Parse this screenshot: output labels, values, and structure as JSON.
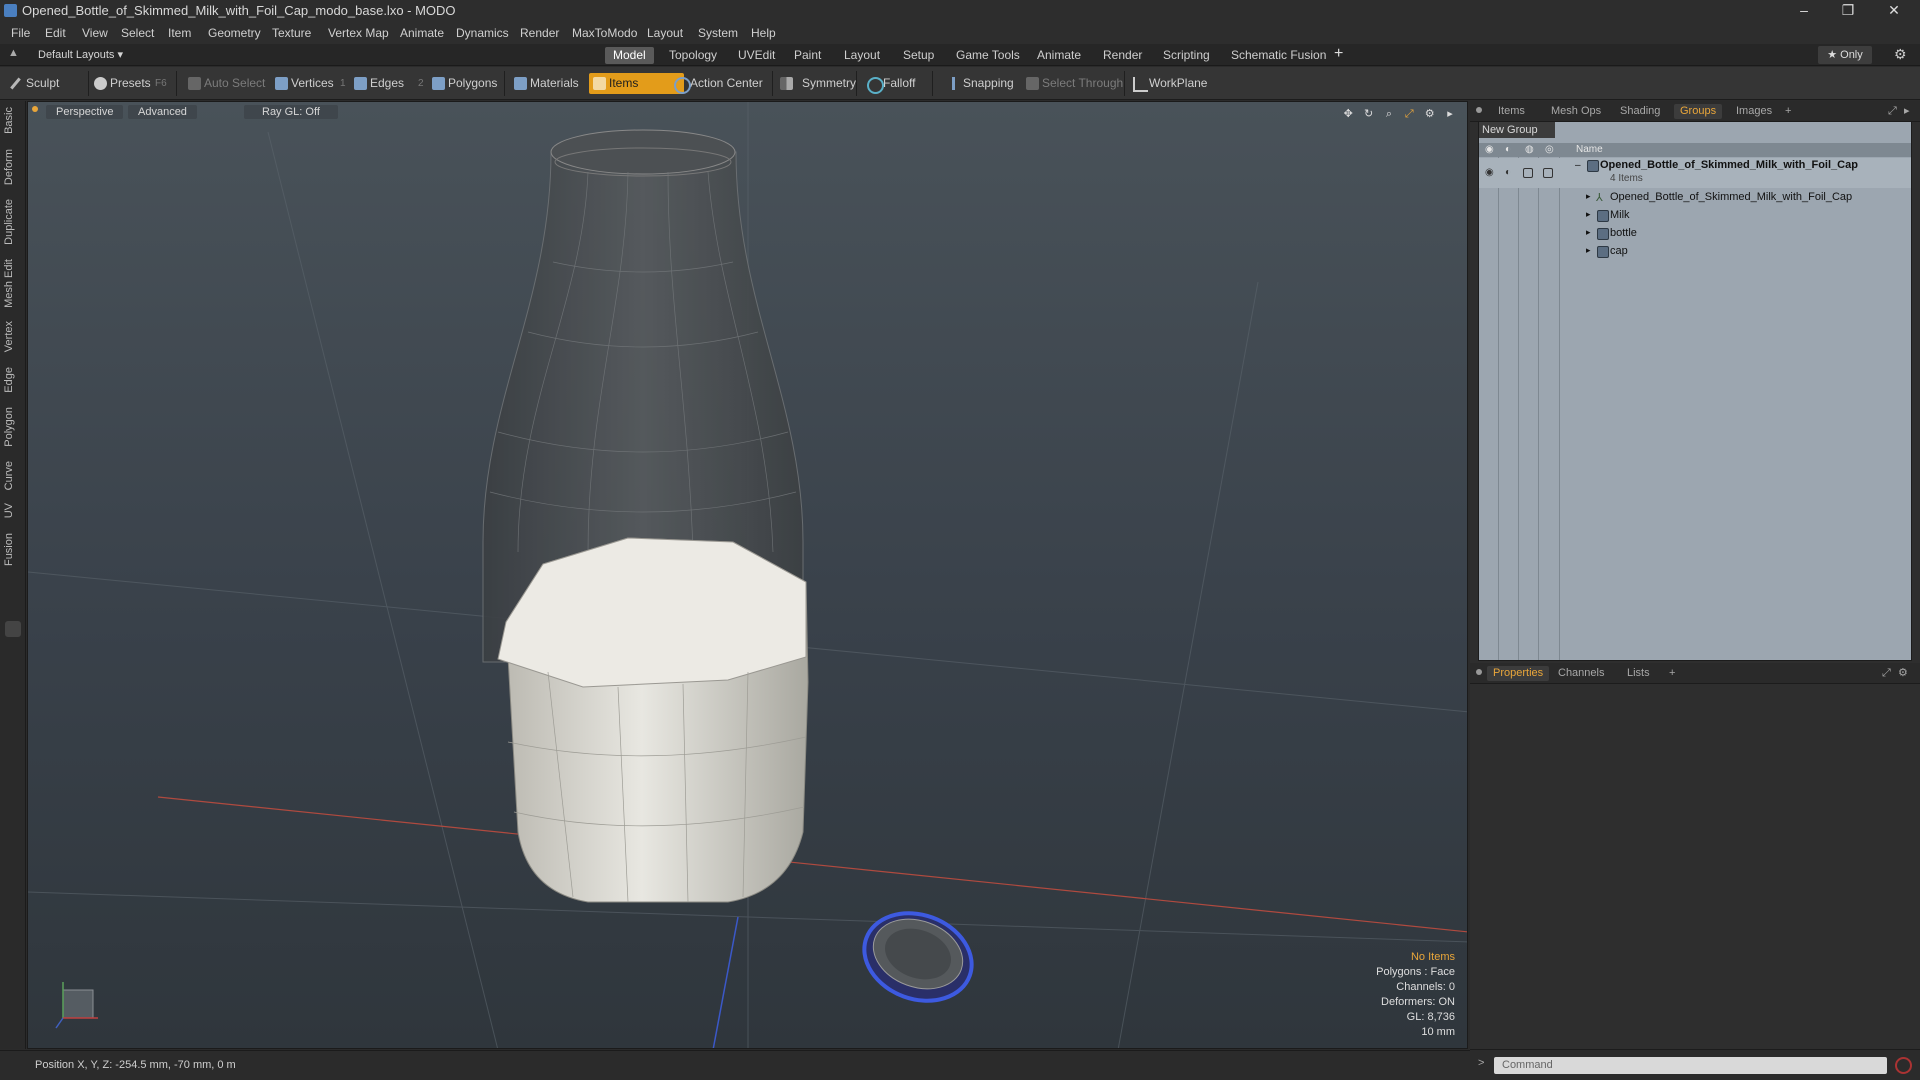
{
  "window": {
    "title": "Opened_Bottle_of_Skimmed_Milk_with_Foil_Cap_modo_base.lxo - MODO",
    "minimize": "–",
    "restore": "❐",
    "close": "✕"
  },
  "menu": [
    "File",
    "Edit",
    "View",
    "Select",
    "Item",
    "Geometry",
    "Texture",
    "Vertex Map",
    "Animate",
    "Dynamics",
    "Render",
    "MaxToModo",
    "Layout",
    "System",
    "Help"
  ],
  "layout_bar": {
    "layouts_label": "Default Layouts ▾",
    "tabs": [
      "Model",
      "Topology",
      "UVEdit",
      "Paint",
      "Layout",
      "Setup",
      "Game Tools",
      "Animate",
      "Render",
      "Scripting",
      "Schematic Fusion"
    ],
    "active_tab": "Model",
    "add": "+",
    "only_label": "★ Only"
  },
  "toolbar": {
    "sculpt": "Sculpt",
    "presets": "Presets",
    "presets_key": "F6",
    "auto_select": "Auto Select",
    "vertices": "Vertices",
    "vertices_key": "1",
    "edges": "Edges",
    "edges_key": "2",
    "polygons": "Polygons",
    "materials": "Materials",
    "items": "Items",
    "action_center": "Action Center",
    "symmetry": "Symmetry",
    "falloff": "Falloff",
    "snapping": "Snapping",
    "select_through": "Select Through",
    "workplane": "WorkPlane"
  },
  "left_tabs": [
    "Basic",
    "Deform",
    "Duplicate",
    "Mesh Edit",
    "Vertex",
    "Edge",
    "Polygon",
    "Curve",
    "UV",
    "Fusion"
  ],
  "viewport": {
    "view_mode": "Perspective",
    "shading": "Advanced",
    "raygl": "Ray GL: Off",
    "stats": {
      "items": "No Items",
      "polygons": "Polygons : Face",
      "channels": "Channels: 0",
      "deformers": "Deformers: ON",
      "gl": "GL: 8,736",
      "scale": "10 mm"
    }
  },
  "status": {
    "position": "Position X, Y, Z:  -254.5 mm, -70 mm, 0 m"
  },
  "groups_panel": {
    "tabs": [
      "Items",
      "Mesh Ops",
      "Shading",
      "Groups",
      "Images"
    ],
    "active_tab": "Groups",
    "new_group": "New Group",
    "column_name": "Name",
    "group_name": "Opened_Bottle_of_Skimmed_Milk_with_Foil_Cap",
    "group_count": "4 Items",
    "children": [
      "Opened_Bottle_of_Skimmed_Milk_with_Foil_Cap",
      "Milk",
      "bottle",
      "cap"
    ]
  },
  "properties_panel": {
    "tabs": [
      "Properties",
      "Channels",
      "Lists"
    ],
    "active_tab": "Properties"
  },
  "command": {
    "placeholder": "Command"
  },
  "colors": {
    "accent": "#e39c1a",
    "viewport_top": "#495259",
    "viewport_bottom": "#2f363c"
  }
}
